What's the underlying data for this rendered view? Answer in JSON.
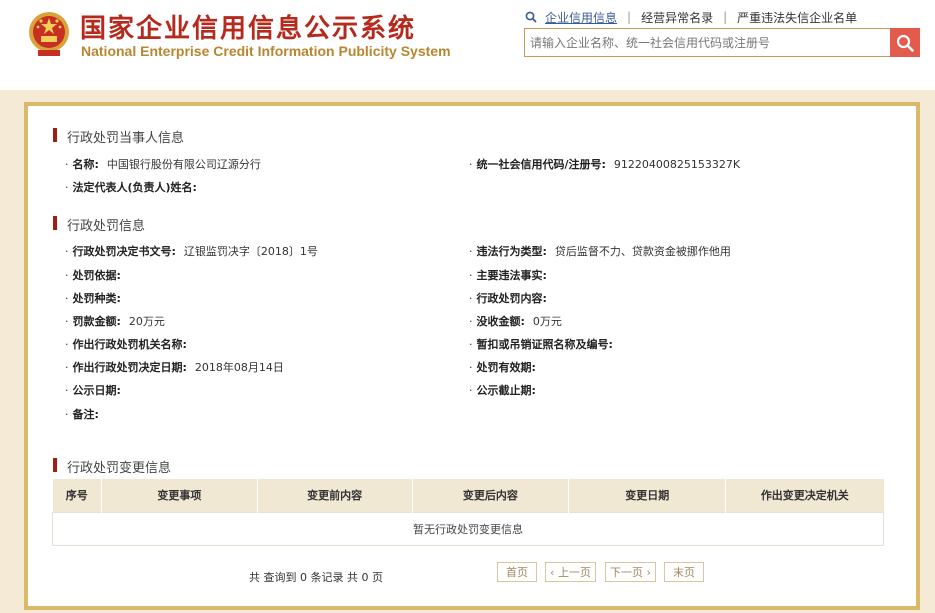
{
  "header": {
    "title_cn": "国家企业信用信息公示系统",
    "title_en": "National Enterprise Credit Information Publicity System",
    "nav": [
      "企业信用信息",
      "经营异常名录",
      "严重违法失信企业名单"
    ],
    "search_placeholder": "请输入企业名称、统一社会信用代码或注册号",
    "icons": {
      "emblem": "national-emblem-icon",
      "search": "search-icon"
    },
    "colors": {
      "title": "#b52a1c",
      "subtitle": "#b8862f",
      "search_button": "#e35b4c",
      "panel_border": "#d9b96a"
    }
  },
  "party": {
    "title": "行政处罚当事人信息",
    "name_label": "名称:",
    "name_value": "中国银行股份有限公司辽源分行",
    "credit_code_label": "统一社会信用代码/注册号:",
    "credit_code_value": "91220400825153327K",
    "legal_rep_label": "法定代表人(负责人)姓名:",
    "legal_rep_value": ""
  },
  "penalty": {
    "title": "行政处罚信息",
    "doc_no_label": "行政处罚决定书文号:",
    "doc_no_value": "辽银监罚决字〔2018〕1号",
    "violation_type_label": "违法行为类型:",
    "violation_type_value": "贷后监督不力、贷款资金被挪作他用",
    "basis_label": "处罚依据:",
    "basis_value": "",
    "main_facts_label": "主要违法事实:",
    "main_facts_value": "",
    "kind_label": "处罚种类:",
    "kind_value": "",
    "content_label": "行政处罚内容:",
    "content_value": "",
    "fine_label": "罚款金额:",
    "fine_value": "20万元",
    "confiscation_label": "没收金额:",
    "confiscation_value": "0万元",
    "authority_label": "作出行政处罚机关名称:",
    "authority_value": "",
    "license_label": "暂扣或吊销证照名称及编号:",
    "license_value": "",
    "decision_date_label": "作出行政处罚决定日期:",
    "decision_date_value": "2018年08月14日",
    "validity_label": "处罚有效期:",
    "validity_value": "",
    "publish_date_label": "公示日期:",
    "publish_date_value": "",
    "publish_end_label": "公示截止期:",
    "publish_end_value": "",
    "remark_label": "备注:",
    "remark_value": ""
  },
  "changes": {
    "title": "行政处罚变更信息",
    "columns": [
      "序号",
      "变更事项",
      "变更前内容",
      "变更后内容",
      "变更日期",
      "作出变更决定机关"
    ],
    "empty_text": "暂无行政处罚变更信息"
  },
  "pager": {
    "info": "共 查询到 0 条记录 共 0 页",
    "first": "首页",
    "prev": "‹ 上一页",
    "next": "下一页 ›",
    "last": "末页"
  }
}
